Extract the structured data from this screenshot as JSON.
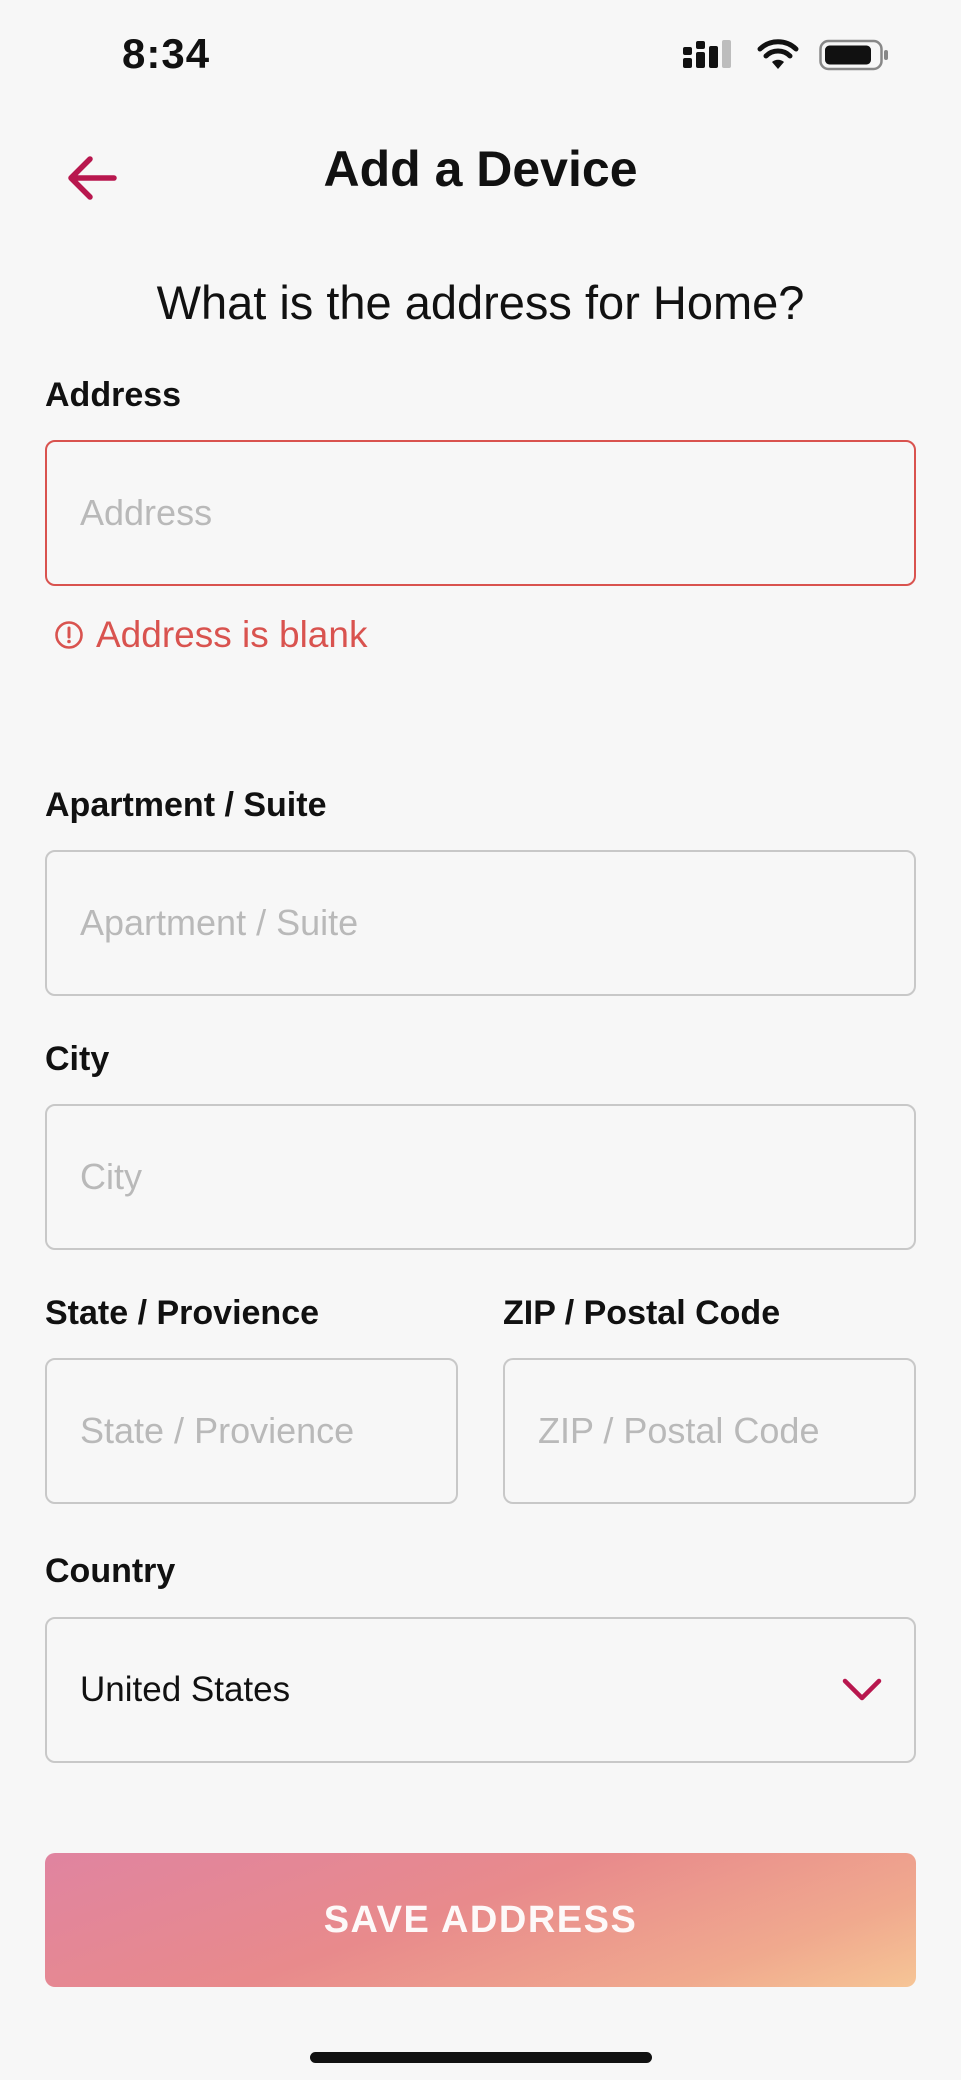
{
  "status_bar": {
    "time": "8:34"
  },
  "header": {
    "title": "Add a Device",
    "back_icon": "arrow-left-icon"
  },
  "question": "What is the address for Home?",
  "form": {
    "address": {
      "label": "Address",
      "placeholder": "Address",
      "value": "",
      "error": "Address is blank"
    },
    "apartment": {
      "label": "Apartment / Suite",
      "placeholder": "Apartment / Suite",
      "value": ""
    },
    "city": {
      "label": "City",
      "placeholder": "City",
      "value": ""
    },
    "state": {
      "label": "State / Provience",
      "placeholder": "State / Provience",
      "value": ""
    },
    "zip": {
      "label": "ZIP / Postal Code",
      "placeholder": "ZIP / Postal Code",
      "value": ""
    },
    "country": {
      "label": "Country",
      "selected": "United States"
    }
  },
  "save_button": {
    "label": "SAVE ADDRESS"
  },
  "colors": {
    "accent": "#b8174e",
    "error": "#d9534f",
    "button_gradient_start": "#e084a0",
    "button_gradient_end": "#f6c596"
  }
}
